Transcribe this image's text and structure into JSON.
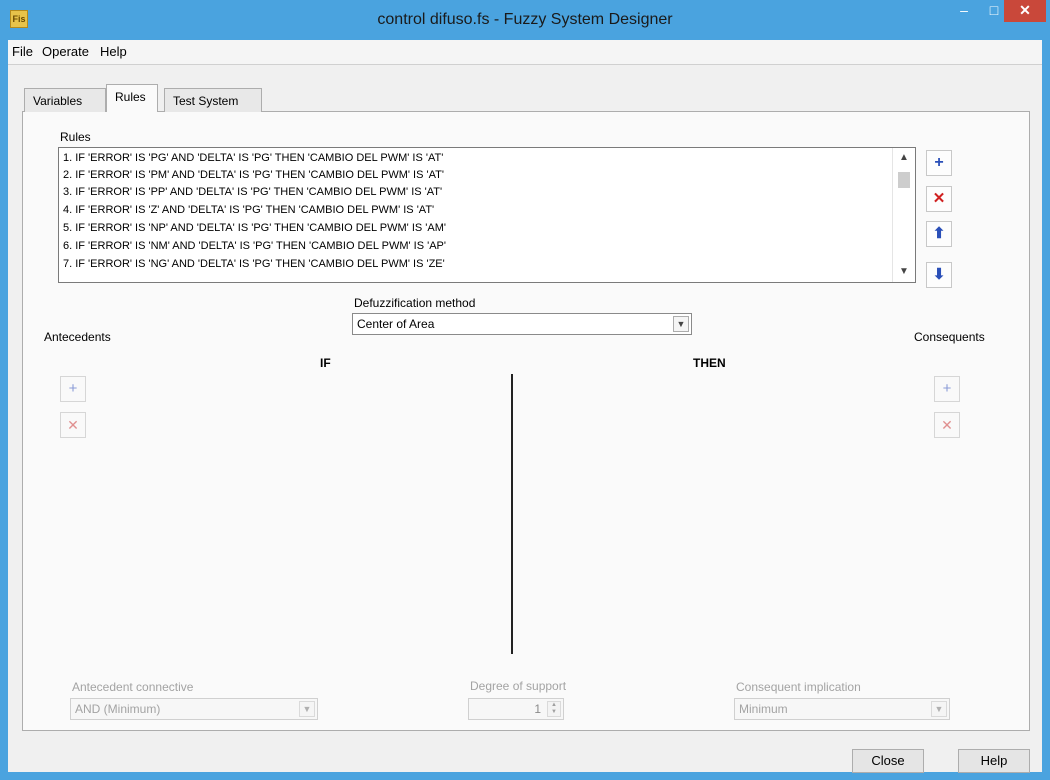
{
  "window": {
    "title": "control difuso.fs - Fuzzy System Designer",
    "icon_text": "Fis",
    "minimize_glyph": "–",
    "maximize_glyph": "□",
    "close_glyph": "✕"
  },
  "menu": [
    "File",
    "Operate",
    "Help"
  ],
  "tabs": [
    {
      "label": "Variables",
      "active": false
    },
    {
      "label": "Rules",
      "active": true
    },
    {
      "label": "Test System",
      "active": false
    }
  ],
  "rules_section": {
    "label": "Rules",
    "rules": [
      "1. IF 'ERROR' IS 'PG' AND 'DELTA' IS 'PG' THEN 'CAMBIO DEL PWM' IS 'AT'",
      "2. IF 'ERROR' IS 'PM' AND 'DELTA' IS 'PG' THEN 'CAMBIO DEL PWM' IS 'AT'",
      "3. IF 'ERROR' IS 'PP' AND 'DELTA' IS 'PG' THEN 'CAMBIO DEL PWM' IS 'AT'",
      "4. IF 'ERROR' IS 'Z' AND 'DELTA' IS 'PG' THEN 'CAMBIO DEL PWM' IS 'AT'",
      "5. IF 'ERROR' IS 'NP' AND 'DELTA' IS 'PG' THEN 'CAMBIO DEL PWM' IS 'AM'",
      "6. IF 'ERROR' IS 'NM' AND 'DELTA' IS 'PG' THEN 'CAMBIO DEL PWM' IS 'AP'",
      "7. IF 'ERROR' IS 'NG' AND 'DELTA' IS 'PG' THEN 'CAMBIO DEL PWM' IS 'ZE'"
    ],
    "add_glyph": "+",
    "delete_glyph": "✕",
    "move_up_glyph": "⬆",
    "move_down_glyph": "⬇"
  },
  "defuzz": {
    "label": "Defuzzification method",
    "value": "Center of Area"
  },
  "antecedents": {
    "label": "Antecedents",
    "if_label": "IF",
    "add_glyph": "+",
    "delete_glyph": "✕"
  },
  "consequents": {
    "label": "Consequents",
    "then_label": "THEN",
    "add_glyph": "+",
    "delete_glyph": "✕"
  },
  "bottom": {
    "antecedent_connective_label": "Antecedent connective",
    "antecedent_connective_value": "AND (Minimum)",
    "degree_label": "Degree of support",
    "degree_value": "1",
    "consequent_implication_label": "Consequent implication",
    "consequent_implication_value": "Minimum"
  },
  "buttons": {
    "close": "Close",
    "help": "Help"
  },
  "colors": {
    "titlebar": "#4aa3df",
    "close_button": "#c9483a",
    "add_icon": "#2a4fb8",
    "delete_icon": "#d02020"
  }
}
